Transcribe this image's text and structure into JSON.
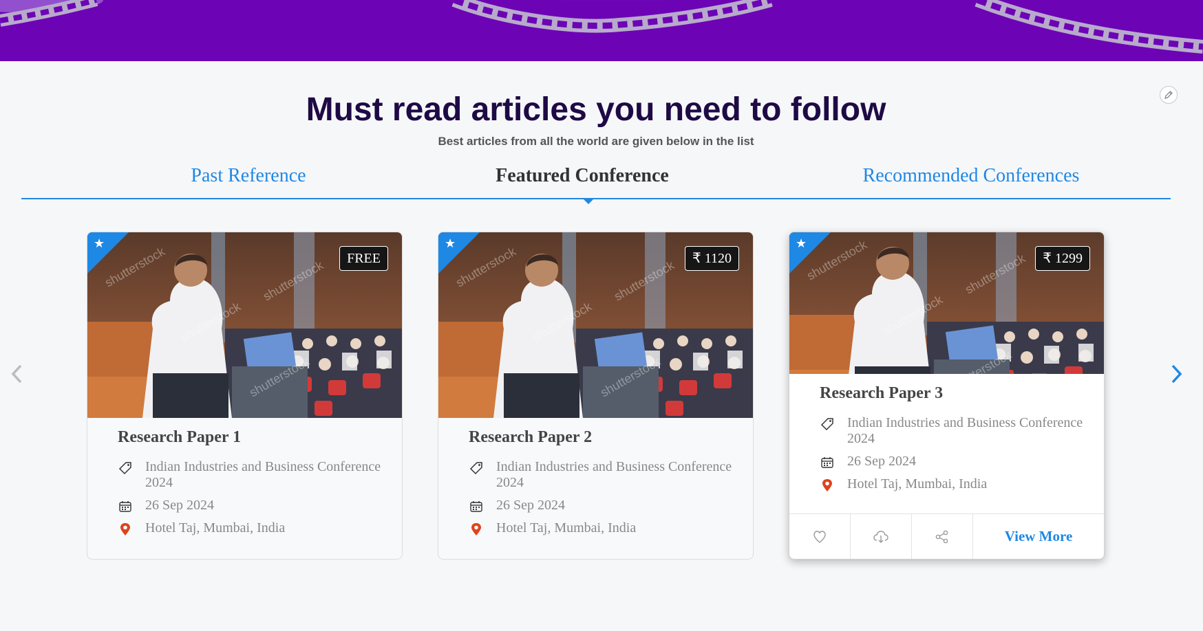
{
  "colors": {
    "hero": "#6c04b5",
    "accent": "#1e88e5",
    "heading": "#1e0a45",
    "pin": "#e0421b"
  },
  "header": {
    "title": "Must read articles you need to follow",
    "subtitle": "Best articles from all the world are given below in the list"
  },
  "tabs": [
    {
      "label": "Past Reference",
      "active": false
    },
    {
      "label": "Featured Conference",
      "active": true
    },
    {
      "label": "Recommended Conferences",
      "active": false
    }
  ],
  "cards": [
    {
      "price": "FREE",
      "title": "Research Paper 1",
      "conference": "Indian Industries and Business Conference 2024",
      "date": "26 Sep 2024",
      "location": "Hotel Taj, Mumbai, India",
      "featured_icon": "star-icon"
    },
    {
      "price": "₹ 1120",
      "title": "Research Paper 2",
      "conference": "Indian Industries and Business Conference 2024",
      "date": "26 Sep 2024",
      "location": "Hotel Taj, Mumbai, India",
      "featured_icon": "star-icon"
    },
    {
      "price": "₹ 1299",
      "title": "Research Paper 3",
      "conference": "Indian Industries and Business Conference 2024",
      "date": "26 Sep 2024",
      "location": "Hotel Taj, Mumbai, India",
      "featured_icon": "star-icon",
      "footer": {
        "view_more": "View More",
        "icons": [
          "heart-icon",
          "cloud-download-icon",
          "share-icon"
        ]
      }
    }
  ],
  "icons": {
    "edit": "pencil-icon",
    "prev": "chevron-left-icon",
    "next": "chevron-right-icon",
    "tag": "tag-icon",
    "date": "calendar-icon",
    "location": "map-pin-icon"
  }
}
